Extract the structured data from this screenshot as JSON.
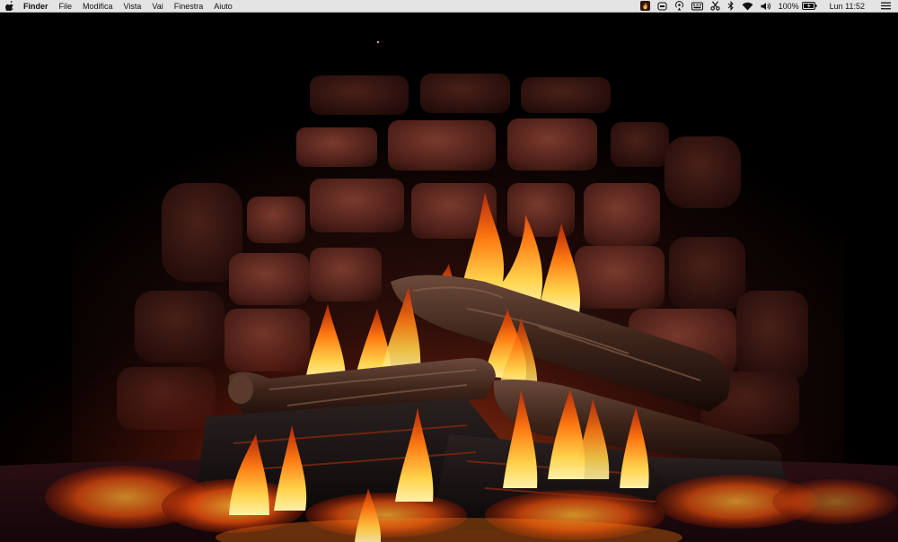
{
  "menubar": {
    "app_name": "Finder",
    "menus": [
      "File",
      "Modifica",
      "Vista",
      "Vai",
      "Finestra",
      "Aiuto"
    ],
    "battery_percent": "100%",
    "clock": "Lun 11:52",
    "status_icons": [
      "fireplace-app-icon",
      "dropbox-icon",
      "airplay-icon",
      "keyboard-icon",
      "scissors-icon",
      "bluetooth-icon",
      "wifi-icon",
      "volume-icon",
      "battery-icon",
      "menu-icon"
    ]
  },
  "desktop": {
    "wallpaper": "burning fireplace with logs in front of a stone wall",
    "colors": {
      "flame_yellow": "#ffd24a",
      "flame_orange": "#ff7a12",
      "flame_red": "#c92a06",
      "stone": "#5a2a22",
      "menubar": "#e4e4e4"
    }
  }
}
